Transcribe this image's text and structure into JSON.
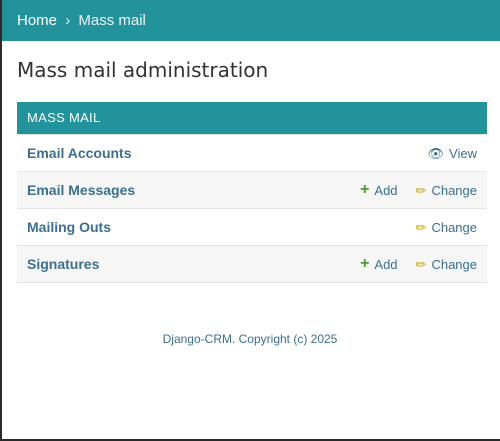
{
  "breadcrumbs": {
    "home": "Home",
    "separator": "›",
    "current": "Mass mail"
  },
  "page_title": "Mass mail administration",
  "module": {
    "caption": "MASS MAIL",
    "rows": [
      {
        "name": "Email Accounts",
        "add": null,
        "action": "View",
        "action_icon": "eye-icon"
      },
      {
        "name": "Email Messages",
        "add": "Add",
        "action": "Change",
        "action_icon": "pencil-icon"
      },
      {
        "name": "Mailing Outs",
        "add": null,
        "action": "Change",
        "action_icon": "pencil-icon"
      },
      {
        "name": "Signatures",
        "add": "Add",
        "action": "Change",
        "action_icon": "pencil-icon"
      }
    ]
  },
  "footer": "Django-CRM. Copyright (c) 2025",
  "colors": {
    "header": "#22939a",
    "link": "#3c6f8c",
    "add": "#4c9a2a",
    "change": "#c9a100"
  }
}
